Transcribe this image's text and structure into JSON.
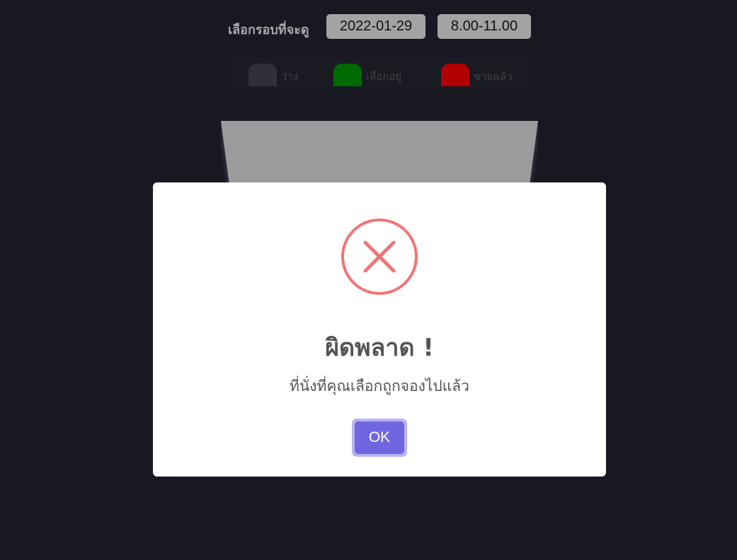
{
  "header": {
    "label": "เลือกรอบที่จะดู",
    "date": "2022-01-29",
    "time": "8.00-11.00"
  },
  "legend": [
    {
      "label": "ว่าง",
      "color": "#30303a"
    },
    {
      "label": "เลือกอยู่",
      "color": "#006b00"
    },
    {
      "label": "ขายแล้ว",
      "color": "#b20000"
    }
  ],
  "colors": {
    "background": "#181722",
    "screen": "#9c9c9c",
    "error": "#f27474",
    "confirm": "#7066e0"
  },
  "dialog": {
    "icon": "error-x-icon",
    "title": "ผิดพลาด !",
    "text": "ที่นั่งที่คุณเลือกถูกจองไปแล้ว",
    "confirm_label": "OK"
  }
}
